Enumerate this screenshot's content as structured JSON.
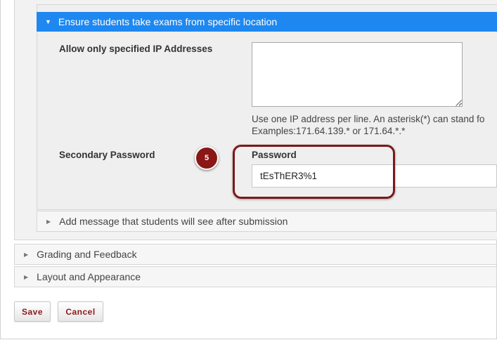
{
  "location_section": {
    "header": "Ensure students take exams from specific location",
    "ip_label": "Allow only specified IP Addresses",
    "ip_value": "",
    "ip_help_line1": "Use one IP address per line. An asterisk(*) can stand fo",
    "ip_help_line2": "Examples:171.64.139.* or 171.64.*.*",
    "secondary_password_label": "Secondary Password",
    "password_label": "Password",
    "password_value": "tEsThER3%1"
  },
  "annotation": {
    "step_number": "5",
    "color": "#8a1616"
  },
  "sections": {
    "message": "Add message that students will see after submission",
    "grading": "Grading and Feedback",
    "layout": "Layout and Appearance"
  },
  "buttons": {
    "save": "Save",
    "cancel": "Cancel"
  },
  "colors": {
    "accent": "#1e88f0",
    "button_text": "#8a1a1a"
  },
  "icons": {
    "expanded": "caret-down-icon",
    "collapsed": "caret-right-icon"
  }
}
